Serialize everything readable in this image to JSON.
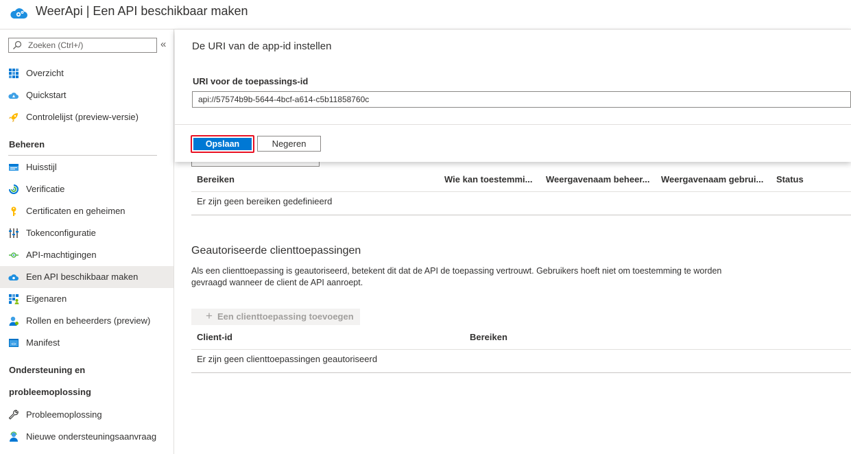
{
  "header": {
    "title": "WeerApi | Een API beschikbaar maken",
    "icon": "cloud-app-icon"
  },
  "sidebar": {
    "search_placeholder": "Zoeken (Ctrl+/)",
    "collapse_glyph": "«",
    "items_top": [
      {
        "label": "Overzicht",
        "icon": "grid-icon"
      },
      {
        "label": "Quickstart",
        "icon": "cloud-quickstart-icon"
      },
      {
        "label": "Controlelijst (preview-versie)",
        "icon": "rocket-icon"
      }
    ],
    "section_beheren": "Beheren",
    "items_manage": [
      {
        "label": "Huisstijl",
        "icon": "branding-icon"
      },
      {
        "label": "Verificatie",
        "icon": "authentication-icon"
      },
      {
        "label": "Certificaten en geheimen",
        "icon": "key-icon"
      },
      {
        "label": "Tokenconfiguratie",
        "icon": "token-bars-icon"
      },
      {
        "label": "API-machtigingen",
        "icon": "api-permissions-icon"
      },
      {
        "label": "Een API beschikbaar maken",
        "icon": "cloud-app-icon",
        "active": true
      },
      {
        "label": "Eigenaren",
        "icon": "owners-grid-icon"
      },
      {
        "label": "Rollen en beheerders (preview)",
        "icon": "roles-user-icon"
      },
      {
        "label": "Manifest",
        "icon": "manifest-icon"
      }
    ],
    "section_support_line1": "Ondersteuning en",
    "section_support_line2": "probleemoplossing",
    "items_support": [
      {
        "label": "Probleemoplossing",
        "icon": "wrench-icon"
      },
      {
        "label": "Nieuwe ondersteuningsaanvraag",
        "icon": "support-user-icon"
      }
    ]
  },
  "dialog": {
    "title": "De URI van de app-id instellen",
    "field_label": "URI voor de toepassings-id",
    "field_value": "api://57574b9b-5644-4bcf-a614-c5b11858760c",
    "save_label": "Opslaan",
    "cancel_label": "Negeren"
  },
  "scopes_table": {
    "headers": [
      "Bereiken",
      "Wie kan toestemmi...",
      "Weergavenaam beheer...",
      "Weergavenaam gebrui...",
      "Status"
    ],
    "empty_text": "Er zijn geen bereiken gedefinieerd"
  },
  "clients": {
    "title": "Geautoriseerde clienttoepassingen",
    "description": "Als een clienttoepassing is geautoriseerd, betekent dit dat de API de toepassing vertrouwt. Gebruikers hoeft niet om toestemming te worden gevraagd wanneer de client de API aanroept.",
    "add_button": "Een clienttoepassing toevoegen",
    "headers": [
      "Client-id",
      "Bereiken"
    ],
    "empty_text": "Er zijn geen clienttoepassingen geautoriseerd"
  },
  "colors": {
    "accent": "#0078d4",
    "highlight_border": "#e81123",
    "active_bg": "#edebe9"
  }
}
